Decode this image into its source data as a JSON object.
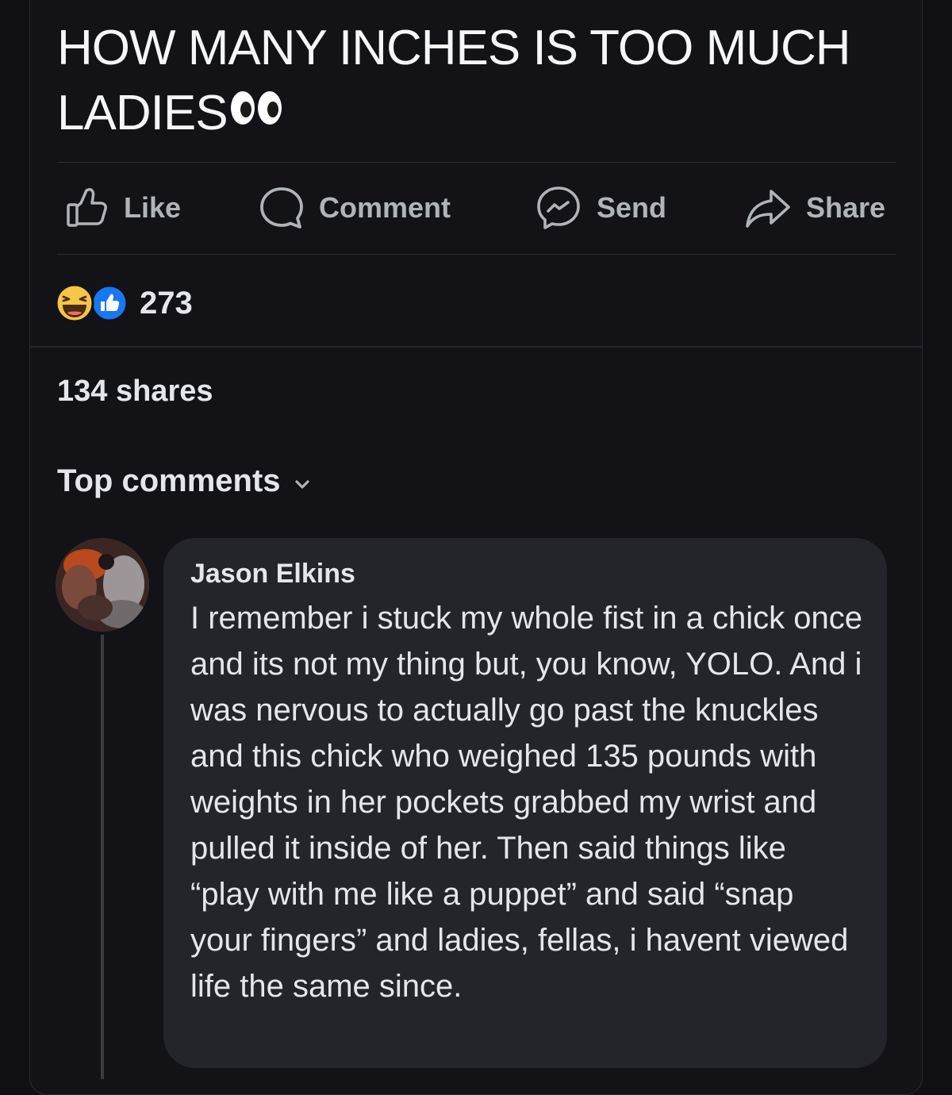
{
  "post": {
    "title": "HOW MANY INCHES IS TOO MUCH LADIES",
    "title_emoji": "eyes-emoji"
  },
  "actions": {
    "like": "Like",
    "comment": "Comment",
    "send": "Send",
    "share": "Share"
  },
  "reactions": {
    "icons": [
      "haha-reaction-icon",
      "like-reaction-icon"
    ],
    "count": "273"
  },
  "shares": "134 shares",
  "comments_header": {
    "label": "Top comments",
    "icon": "chevron-down-icon"
  },
  "comment": {
    "author": "Jason Elkins",
    "text": "I remember i stuck my whole fist in a chick once and its not my thing but, you know, YOLO. And i was nervous to actually go past the knuckles and this chick who weighed 135 pounds with weights in her pockets grabbed my wrist and pulled it inside of her. Then said things like “play with me like a puppet” and said “snap your fingers” and ladies, fellas, i havent viewed life the same since."
  },
  "colors": {
    "background": "#0f0f14",
    "card": "#121217",
    "bubble": "#24252b",
    "text_primary": "#e4e6eb",
    "text_secondary": "#b0b3b8",
    "like_blue": "#1877f2",
    "haha_yellow": "#f7c547"
  }
}
